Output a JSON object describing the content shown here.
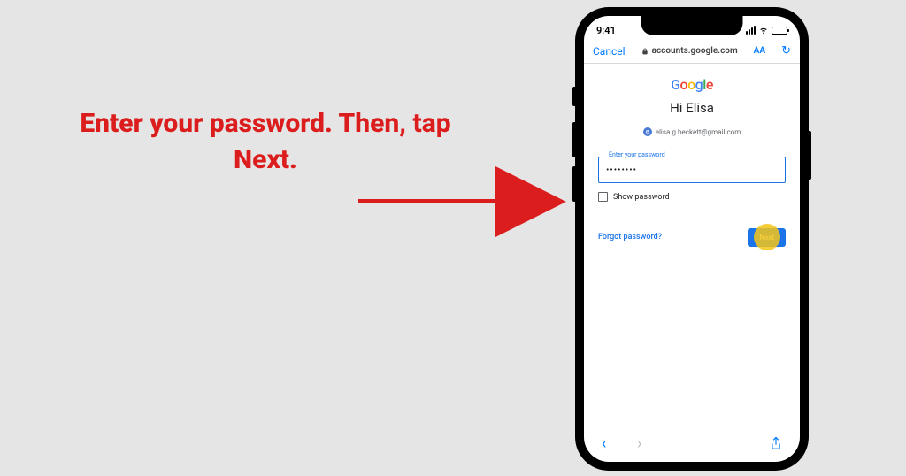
{
  "instruction": {
    "text": "Enter your password. Then, tap Next."
  },
  "statusBar": {
    "time": "9:41"
  },
  "browser": {
    "cancel": "Cancel",
    "url": "accounts.google.com",
    "aa": "AA"
  },
  "google": {
    "logo": {
      "g1": "G",
      "g2": "o",
      "g3": "o",
      "g4": "g",
      "g5": "l",
      "g6": "e"
    },
    "greeting": "Hi Elisa",
    "email": "elisa.g.beckett@gmail.com"
  },
  "passwordField": {
    "label": "Enter your password",
    "value": "••••••••"
  },
  "showPassword": {
    "label": "Show password"
  },
  "actions": {
    "forgot": "Forgot password?",
    "next": "Next"
  }
}
